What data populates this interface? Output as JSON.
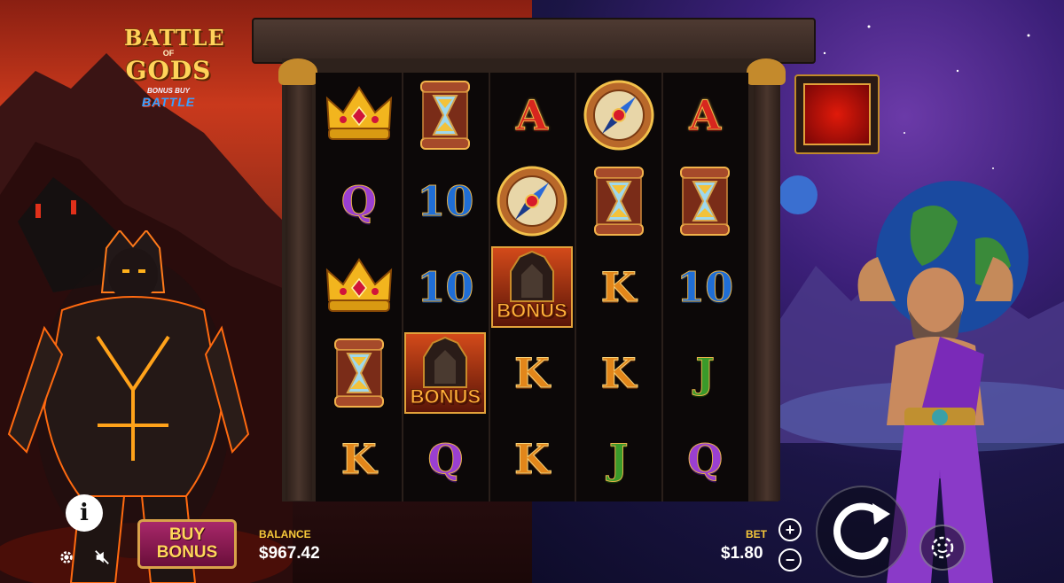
{
  "logo": {
    "line1": "BATTLE",
    "of": "OF",
    "line2": "GODS",
    "sub_small": "BONUS BUY",
    "sub_big": "BATTLE"
  },
  "reels": [
    [
      "crown",
      "hourglass",
      "A",
      "compass",
      "A"
    ],
    [
      "Q",
      "10",
      "compass",
      "hourglass",
      "hourglass"
    ],
    [
      "crown",
      "10",
      "bonus",
      "K",
      "10"
    ],
    [
      "hourglass",
      "bonus",
      "K",
      "K",
      "J"
    ],
    [
      "K",
      "Q",
      "K",
      "J",
      "Q"
    ]
  ],
  "symbol_labels": {
    "bonus": "BONUS"
  },
  "controls": {
    "info_label": "i",
    "buy_bonus_line1": "BUY",
    "buy_bonus_line2": "BONUS",
    "balance_label": "BALANCE",
    "balance_value": "$967.42",
    "bet_label": "BET",
    "bet_value": "$1.80",
    "plus": "+",
    "minus": "−"
  },
  "colors": {
    "gold": "#f7c93a",
    "buy_bonus_bg": "#8a1a52"
  }
}
